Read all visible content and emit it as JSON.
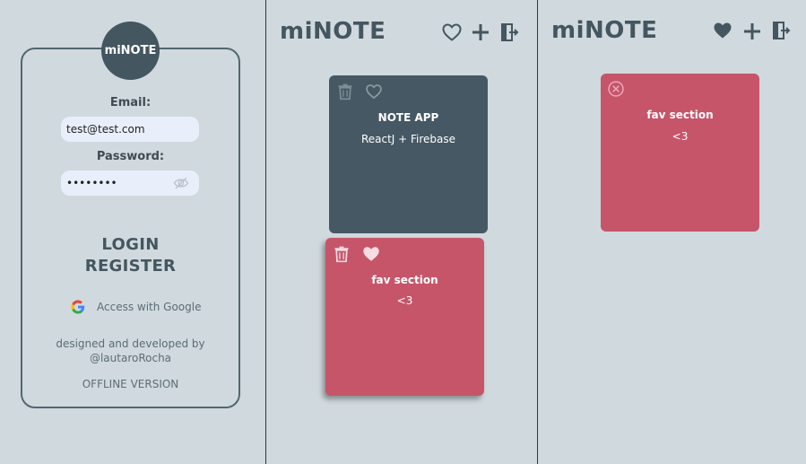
{
  "app": {
    "logo": "miNOTE",
    "title": "miNOTE"
  },
  "login": {
    "email_label": "Email:",
    "email_value": "test@test.com",
    "password_label": "Password:",
    "password_value": "••••••••",
    "login_label": "LOGIN",
    "register_label": "REGISTER",
    "google_label": "Access with Google",
    "credit_line1": "designed and developed by",
    "credit_line2": "@lautaroRocha",
    "offline_label": "OFFLINE VERSION"
  },
  "notes_panel": {
    "notes": [
      {
        "title": "NOTE APP",
        "body": "ReactJ + Firebase",
        "color": "#465864",
        "favorite": false
      },
      {
        "title": "fav section",
        "body": "<3",
        "color": "#c6556a",
        "favorite": true
      }
    ]
  },
  "favs_panel": {
    "notes": [
      {
        "title": "fav section",
        "body": "<3",
        "color": "#c6556a"
      }
    ]
  },
  "icons": {
    "heart": "heart-icon",
    "plus": "plus-icon",
    "logout": "logout-icon",
    "trash": "trash-icon",
    "close": "close-circle-icon",
    "eye": "eye-off-icon",
    "google": "google-icon"
  }
}
